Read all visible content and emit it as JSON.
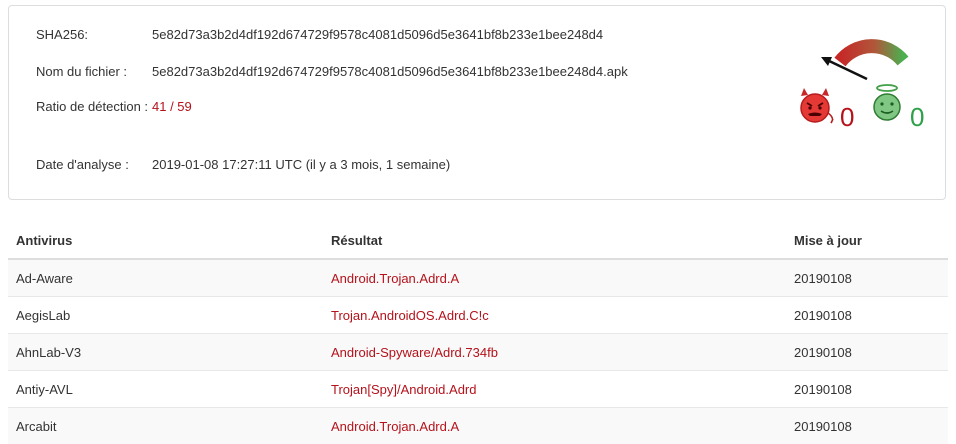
{
  "info": {
    "sha256_label": "SHA256:",
    "sha256_value": "5e82d73a3b2d4df192d674729f9578c4081d5096d5e3641bf8b233e1bee248d4",
    "filename_label": "Nom du fichier :",
    "filename_value": "5e82d73a3b2d4df192d674729f9578c4081d5096d5e3641bf8b233e1bee248d4.apk",
    "ratio_label": "Ratio de détection :",
    "ratio_value": "41 / 59",
    "date_label": "Date d'analyse :",
    "date_value": "2019-01-08 17:27:11 UTC (il y a 3 mois, 1 semaine)"
  },
  "score": {
    "malicious_count": "0",
    "harmless_count": "0",
    "malicious_icon": "devil-face-icon",
    "harmless_icon": "angel-face-icon",
    "gauge_icon": "gauge-icon",
    "colors": {
      "malicious": "#b5121b",
      "harmless": "#2ea04a"
    }
  },
  "table": {
    "headers": {
      "antivirus": "Antivirus",
      "result": "Résultat",
      "update": "Mise à jour"
    },
    "rows": [
      {
        "antivirus": "Ad-Aware",
        "result": "Android.Trojan.Adrd.A",
        "update": "20190108"
      },
      {
        "antivirus": "AegisLab",
        "result": "Trojan.AndroidOS.Adrd.C!c",
        "update": "20190108"
      },
      {
        "antivirus": "AhnLab-V3",
        "result": "Android-Spyware/Adrd.734fb",
        "update": "20190108"
      },
      {
        "antivirus": "Antiy-AVL",
        "result": "Trojan[Spy]/Android.Adrd",
        "update": "20190108"
      },
      {
        "antivirus": "Arcabit",
        "result": "Android.Trojan.Adrd.A",
        "update": "20190108"
      }
    ]
  }
}
